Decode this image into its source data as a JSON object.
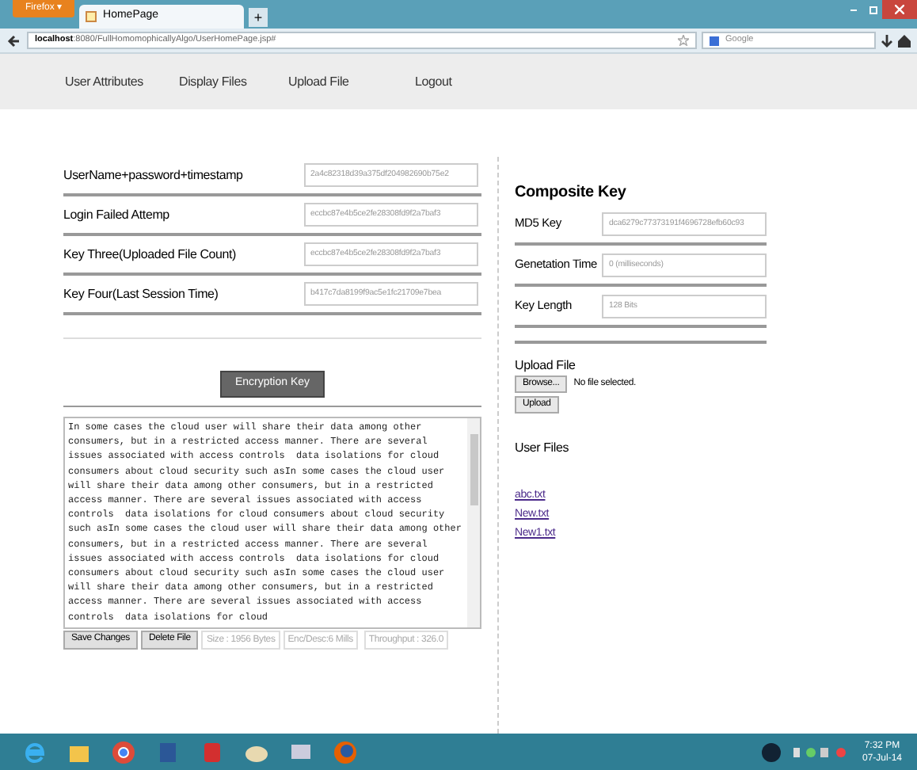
{
  "browser": {
    "menu_button": "Firefox ▾",
    "tab_title": "HomePage",
    "new_tab": "+",
    "url_host": "localhost",
    "url_path": ":8080/FullHomomophicallyAlgo/UserHomePage.jsp#",
    "search_placeholder": "Google"
  },
  "nav": [
    {
      "label": "User Attributes"
    },
    {
      "label": "Display Files"
    },
    {
      "label": "Upload File"
    },
    {
      "label": "Logout"
    }
  ],
  "attributes": [
    {
      "label": "UserName+password+timestamp",
      "value": "2a4c82318d39a375df204982690b75e2"
    },
    {
      "label": "Login Failed Attemp",
      "value": "eccbc87e4b5ce2fe28308fd9f2a7baf3"
    },
    {
      "label": "Key Three(Uploaded File Count)",
      "value": "eccbc87e4b5ce2fe28308fd9f2a7baf3"
    },
    {
      "label": "Key Four(Last Session Time)",
      "value": "b417c7da8199f9ac5e1fc21709e7bea"
    }
  ],
  "encryption_button": "Encryption Key",
  "file_content": "In some cases the cloud user will share their data among other consumers, but in a restricted access manner. There are several issues associated with access controls  data isolations for cloud consumers about cloud security such asIn some cases the cloud user will share their data among other consumers, but in a restricted access manner. There are several issues associated with access controls  data isolations for cloud consumers about cloud security such asIn some cases the cloud user will share their data among other consumers, but in a restricted access manner. There are several issues associated with access controls  data isolations for cloud consumers about cloud security such asIn some cases the cloud user will share their data among other consumers, but in a restricted access manner. There are several issues associated with access controls  data isolations for cloud",
  "file_actions": [
    "Save Changes",
    "Delete File"
  ],
  "file_stats": [
    "Size : 1956 Bytes",
    "Enc/Desc:6 Mills",
    "Throughput : 326.0"
  ],
  "composite": {
    "title": "Composite Key",
    "rows": [
      {
        "label": "MD5 Key",
        "value": "dca6279c77373191f4696728efb60c93"
      },
      {
        "label": "Genetation Time",
        "value": "0 (milliseconds)"
      },
      {
        "label": "Key Length",
        "value": "128 Bits"
      }
    ]
  },
  "upload": {
    "title": "Upload File",
    "browse": "Browse...",
    "status": "No file selected.",
    "button": "Upload"
  },
  "user_files": {
    "title": "User Files",
    "files": [
      "abc.txt",
      "New.txt",
      "New1.txt"
    ]
  },
  "clock": {
    "time": "7:32 PM",
    "date": "07-Jul-14"
  }
}
